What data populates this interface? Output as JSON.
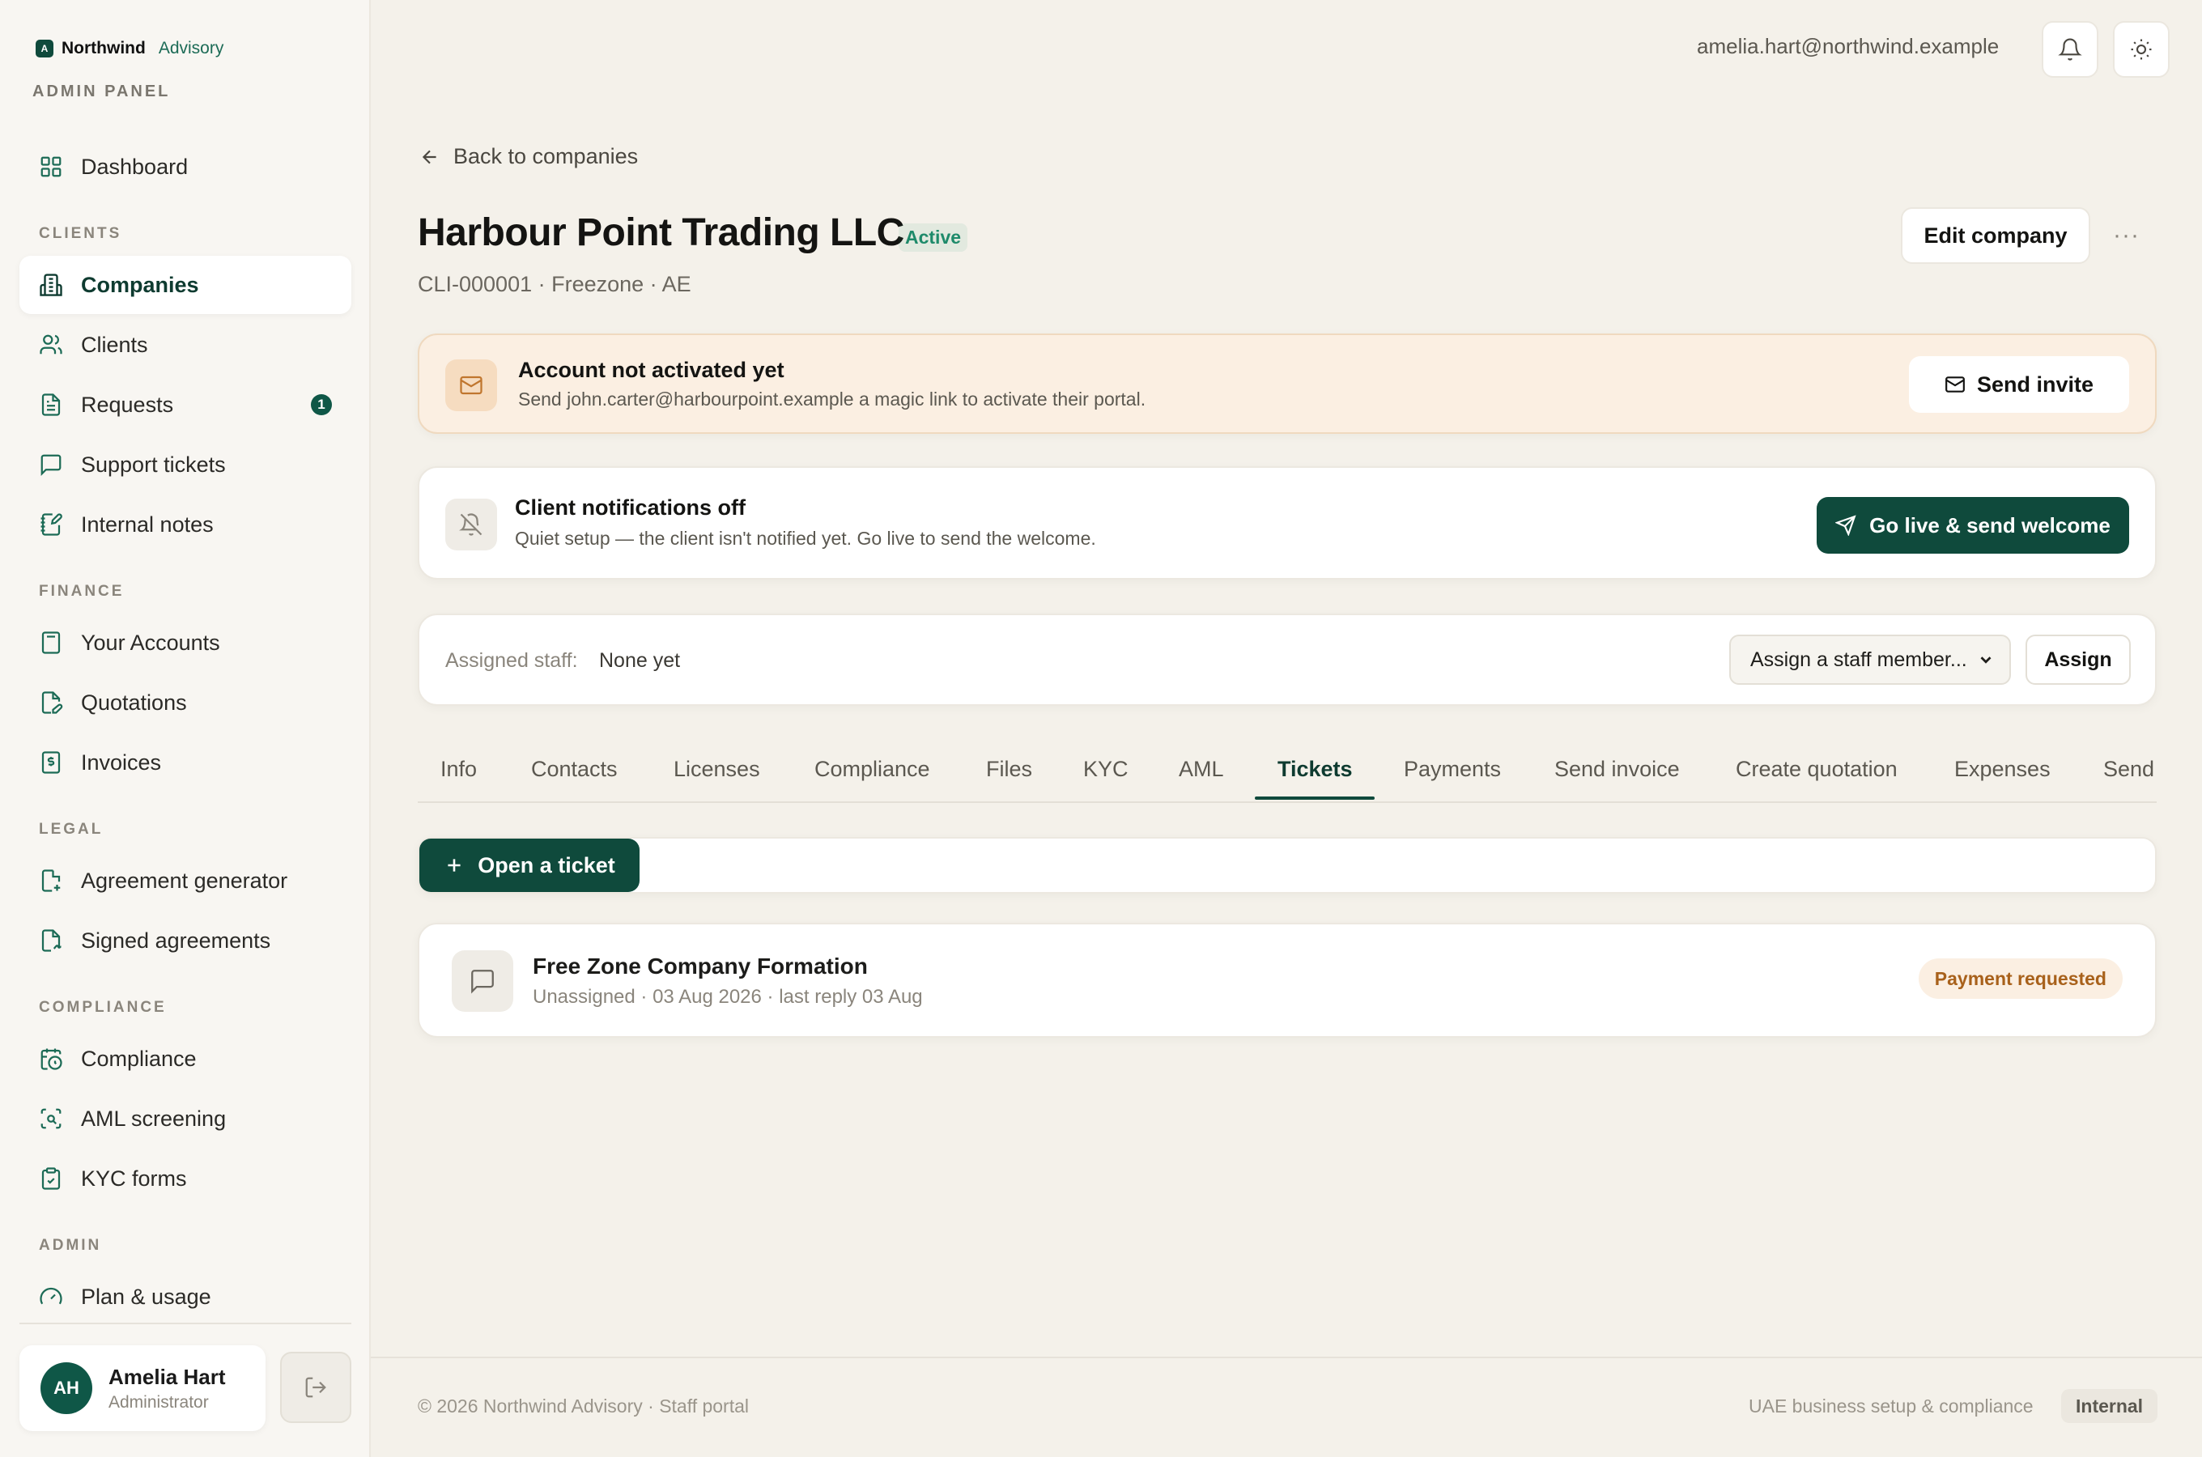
{
  "brand": {
    "mark": "A",
    "name": "Northwind",
    "sub": "Advisory",
    "panel": "ADMIN PANEL"
  },
  "sidebar": {
    "dashboard": "Dashboard",
    "sections": {
      "clients": "CLIENTS",
      "finance": "FINANCE",
      "legal": "LEGAL",
      "compliance": "COMPLIANCE",
      "admin": "ADMIN"
    },
    "items": {
      "companies": "Companies",
      "clients": "Clients",
      "requests": "Requests",
      "requests_badge": "1",
      "support_tickets": "Support tickets",
      "internal_notes": "Internal notes",
      "your_accounts": "Your Accounts",
      "quotations": "Quotations",
      "invoices": "Invoices",
      "agreement_generator": "Agreement generator",
      "signed_agreements": "Signed agreements",
      "compliance": "Compliance",
      "aml_screening": "AML screening",
      "kyc_forms": "KYC forms",
      "plan_usage": "Plan & usage"
    },
    "user": {
      "initials": "AH",
      "name": "Amelia Hart",
      "role": "Administrator"
    }
  },
  "topbar": {
    "email": "amelia.hart@northwind.example"
  },
  "main": {
    "back": "Back to companies",
    "title": "Harbour Point Trading LLC",
    "status": "Active",
    "subtitle": "CLI-000001 · Freezone · AE",
    "edit": "Edit company",
    "more": "···",
    "invite_alert": {
      "title": "Account not activated yet",
      "text": "Send john.carter@harbourpoint.example a magic link to activate their portal.",
      "button": "Send invite"
    },
    "notif_alert": {
      "title": "Client notifications off",
      "text": "Quiet setup — the client isn't notified yet. Go live to send the welcome.",
      "button": "Go live & send welcome"
    },
    "staff": {
      "label": "Assigned staff:",
      "value": "None yet",
      "select": "Assign a staff member...",
      "button": "Assign"
    },
    "tabs": [
      "Info",
      "Contacts",
      "Licenses",
      "Compliance",
      "Files",
      "KYC",
      "AML",
      "Tickets",
      "Payments",
      "Send invoice",
      "Create quotation",
      "Expenses",
      "Send"
    ],
    "active_tab": "Tickets",
    "open_ticket": "Open a ticket",
    "ticket": {
      "title": "Free Zone Company Formation",
      "meta": "Unassigned · 03 Aug 2026 · last reply 03 Aug",
      "status": "Payment requested"
    }
  },
  "footer": {
    "left": "© 2026 Northwind Advisory · Staff portal",
    "right": "UAE business setup & compliance",
    "tag": "Internal"
  },
  "colors": {
    "accent": "#0f4a3c",
    "warning_bg": "#fbefe2",
    "warning_text": "#a8611b",
    "active_status": "#1e8a6a"
  }
}
